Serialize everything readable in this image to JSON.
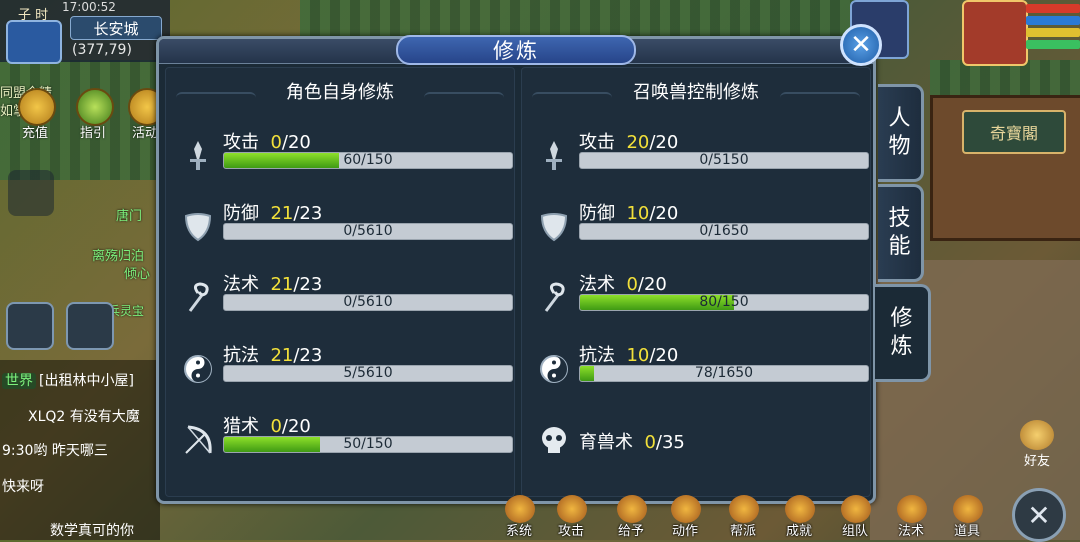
{
  "hud": {
    "shichen": "子 时",
    "time": "17:00:52",
    "city": "长安城",
    "coords": "(377,79)",
    "left_buttons": [
      {
        "label": "充值"
      },
      {
        "label": "指引"
      },
      {
        "label": "活动"
      }
    ],
    "partial_text_a": "同盟全精",
    "partial_text_b": "如掌",
    "scene_label_1": "唐门",
    "scene_label_2": "离殇归泊",
    "scene_label_3": "倾心",
    "scene_label_4": "兵灵宝"
  },
  "chat": {
    "world_tag": "世界",
    "lines": [
      "[出租林中小屋]",
      "XLQ2 有没有大魔",
      "9:30哟   昨天哪三",
      "快来呀",
      "数学真可的你"
    ]
  },
  "shop_sign": "奇寶閣",
  "panel": {
    "title": "修炼",
    "close_glyph": "✕",
    "left": {
      "heading": "角色自身修炼",
      "rows": [
        {
          "icon": "sword-icon",
          "name": "攻击",
          "current": "0",
          "max": "/20",
          "progress": "60/150",
          "fraction": 0.4
        },
        {
          "icon": "shield-icon",
          "name": "防御",
          "current": "21",
          "max": "/23",
          "progress": "0/5610",
          "fraction": 0.0
        },
        {
          "icon": "staff-icon",
          "name": "法术",
          "current": "21",
          "max": "/23",
          "progress": "0/5610",
          "fraction": 0.0
        },
        {
          "icon": "yinyang-icon",
          "name": "抗法",
          "current": "21",
          "max": "/23",
          "progress": "5/5610",
          "fraction": 0.001
        },
        {
          "icon": "bow-icon",
          "name": "猎术",
          "current": "0",
          "max": "/20",
          "progress": "50/150",
          "fraction": 0.333
        }
      ]
    },
    "right": {
      "heading": "召唤兽控制修炼",
      "rows": [
        {
          "icon": "sword-icon",
          "name": "攻击",
          "current": "20",
          "max": "/20",
          "progress": "0/5150",
          "fraction": 0.0
        },
        {
          "icon": "shield-icon",
          "name": "防御",
          "current": "10",
          "max": "/20",
          "progress": "0/1650",
          "fraction": 0.0
        },
        {
          "icon": "staff-icon",
          "name": "法术",
          "current": "0",
          "max": "/20",
          "progress": "80/150",
          "fraction": 0.533
        },
        {
          "icon": "yinyang-icon",
          "name": "抗法",
          "current": "10",
          "max": "/20",
          "progress": "78/1650",
          "fraction": 0.047
        }
      ],
      "extra": {
        "icon": "skull-icon",
        "name": "育兽术",
        "current": "0",
        "max": "/35"
      }
    }
  },
  "tabs": [
    {
      "label_1": "人",
      "label_2": "物",
      "active": false
    },
    {
      "label_1": "技",
      "label_2": "能",
      "active": false
    },
    {
      "label_1": "修",
      "label_2": "炼",
      "active": true
    }
  ],
  "bottom_bar": [
    {
      "label": "系统"
    },
    {
      "label": "攻击"
    },
    {
      "label": "给予"
    },
    {
      "label": "动作"
    },
    {
      "label": "帮派"
    },
    {
      "label": "成就"
    },
    {
      "label": "组队"
    },
    {
      "label": "法术"
    },
    {
      "label": "道具"
    }
  ],
  "friend_label": "好友",
  "bottom_close_glyph": "✕",
  "colors": {
    "accent_yellow": "#f2e03a",
    "bar_green": "#5fbf1e",
    "panel_bg": "#1b2a36"
  }
}
